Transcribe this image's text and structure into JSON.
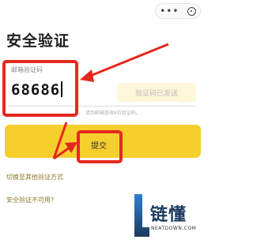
{
  "header": {
    "more_glyph": "•••",
    "page_title": "安全验证"
  },
  "verification": {
    "field_label": "邮箱验证码",
    "code_value": "68686",
    "send_status": "验证码已发送",
    "hint": "请到邮箱查收6位验证码。"
  },
  "actions": {
    "submit_label": "提交",
    "switch_method_link": "切换至其他验证方式",
    "unavailable_link": "安全验证不可用?"
  },
  "watermark": {
    "name": "链懂",
    "url": "NEATDOWN.COM"
  },
  "colors": {
    "accent": "#f7cf2d",
    "annotation": "#e5281f",
    "link": "#8c7a2c"
  }
}
